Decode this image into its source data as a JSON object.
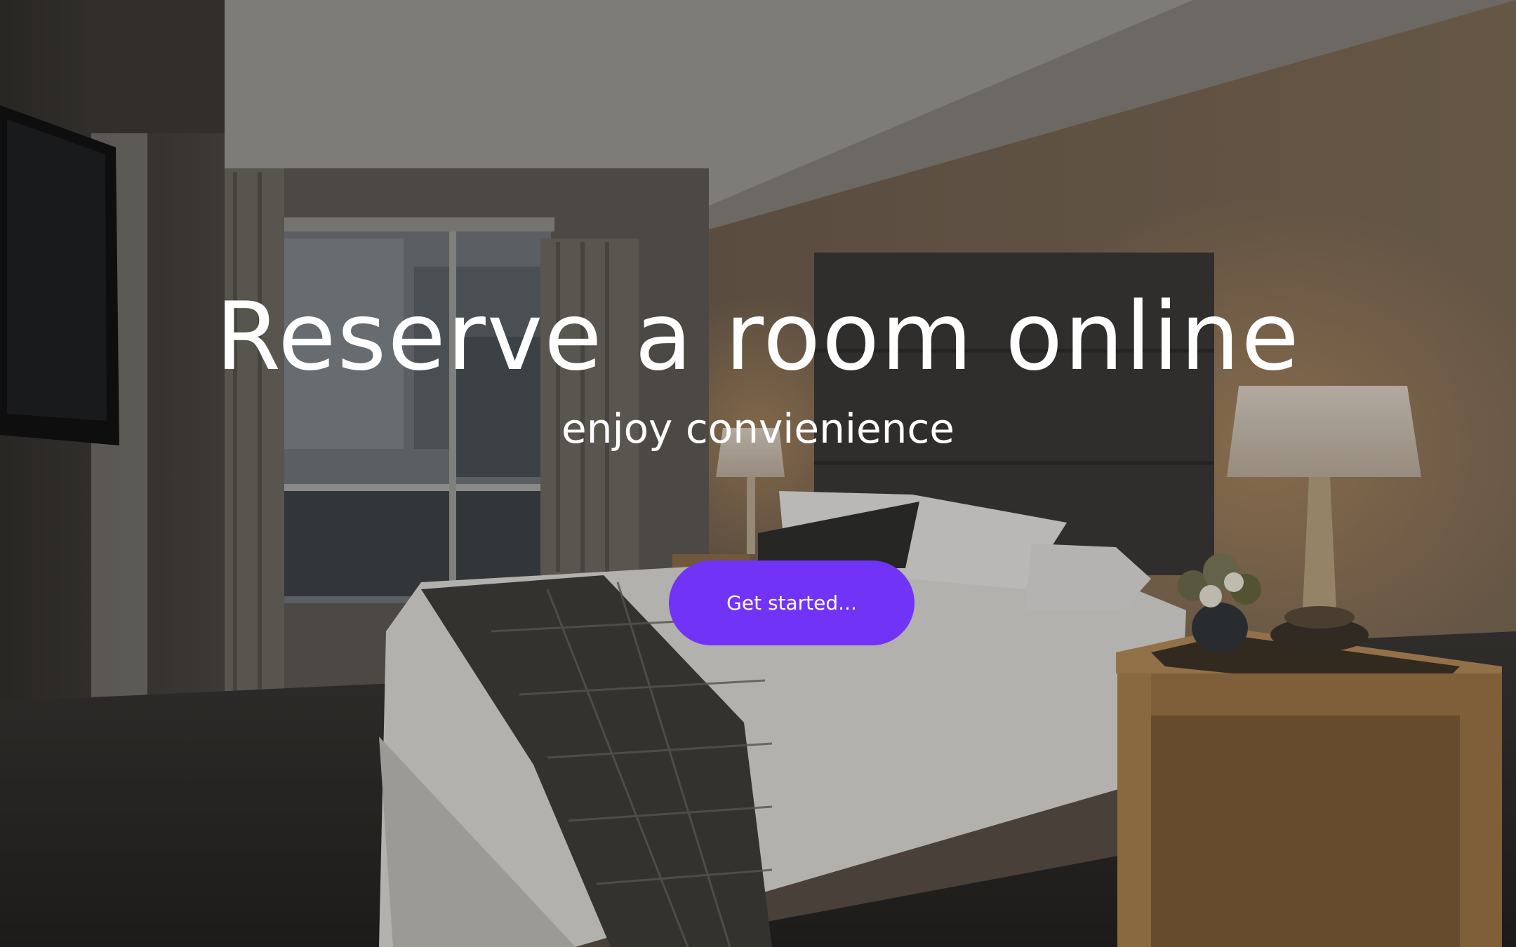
{
  "hero": {
    "title": "Reserve a room online",
    "subtitle": "enjoy convienience",
    "cta_label": "Get started...",
    "cta_color": "#7133f5"
  },
  "background": {
    "description_icon": "hotel-room-photo"
  }
}
